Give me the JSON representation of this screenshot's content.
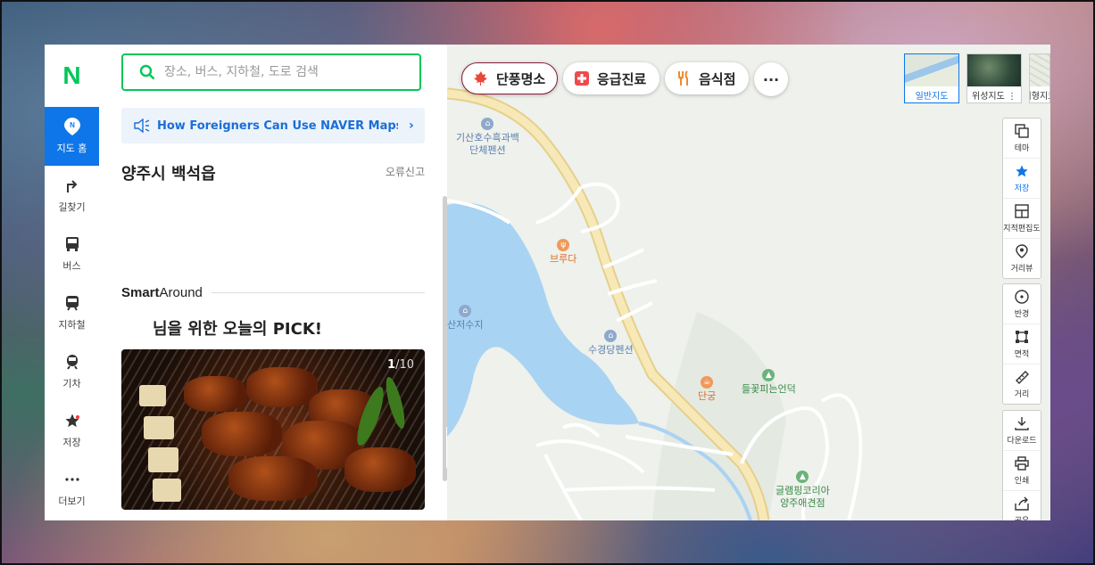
{
  "nav": {
    "logo": "N",
    "items": [
      {
        "label": "지도 홈",
        "icon": "map-pin-icon",
        "active": true
      },
      {
        "label": "길찾기",
        "icon": "directions-icon"
      },
      {
        "label": "버스",
        "icon": "bus-icon"
      },
      {
        "label": "지하철",
        "icon": "subway-icon"
      },
      {
        "label": "기차",
        "icon": "train-icon"
      },
      {
        "label": "저장",
        "icon": "star-icon"
      },
      {
        "label": "더보기",
        "icon": "more-icon"
      }
    ]
  },
  "panel": {
    "search_placeholder": "장소, 버스, 지하철, 도로 검색",
    "notice": "How Foreigners Can Use NAVER Maps f...",
    "region": "양주시 백석읍",
    "report": "오류신고",
    "smart_around_bold": "Smart",
    "smart_around_rest": "Around",
    "pick_title": "님을 위한 오늘의 PICK!",
    "photo_index": "1",
    "photo_total": "/10"
  },
  "map": {
    "chips": [
      {
        "label": "단풍명소",
        "icon": "maple-leaf-icon"
      },
      {
        "label": "응급진료",
        "icon": "medical-cross-icon"
      },
      {
        "label": "음식점",
        "icon": "restaurant-icon"
      }
    ],
    "more": "···",
    "map_types": [
      {
        "label": "일반지도",
        "selected": true
      },
      {
        "label": "위성지도 ⋮"
      },
      {
        "label": "지형지도"
      }
    ],
    "tools_group1": [
      {
        "label": "테마",
        "icon": "layers-icon"
      },
      {
        "label": "저장",
        "icon": "star-icon"
      },
      {
        "label": "지적편집도",
        "icon": "cadastral-icon"
      },
      {
        "label": "거리뷰",
        "icon": "street-view-icon"
      }
    ],
    "tools_group2": [
      {
        "label": "반경",
        "icon": "radius-icon"
      },
      {
        "label": "면적",
        "icon": "area-icon"
      },
      {
        "label": "거리",
        "icon": "ruler-icon"
      }
    ],
    "tools_group3": [
      {
        "label": "다운로드",
        "icon": "download-icon"
      },
      {
        "label": "인쇄",
        "icon": "print-icon"
      },
      {
        "label": "공유",
        "icon": "share-icon"
      }
    ],
    "pois": [
      {
        "name": "기산호수흑과백\n단체펜션",
        "kind": "lodging"
      },
      {
        "name": "브루다",
        "kind": "restaurant"
      },
      {
        "name": "산저수지",
        "kind": "lodging"
      },
      {
        "name": "수경당펜션",
        "kind": "lodging"
      },
      {
        "name": "단궁",
        "kind": "restaurant"
      },
      {
        "name": "들꽃피는언덕",
        "kind": "park"
      },
      {
        "name": "글램핑코리아\n양주애견점",
        "kind": "park"
      }
    ]
  }
}
